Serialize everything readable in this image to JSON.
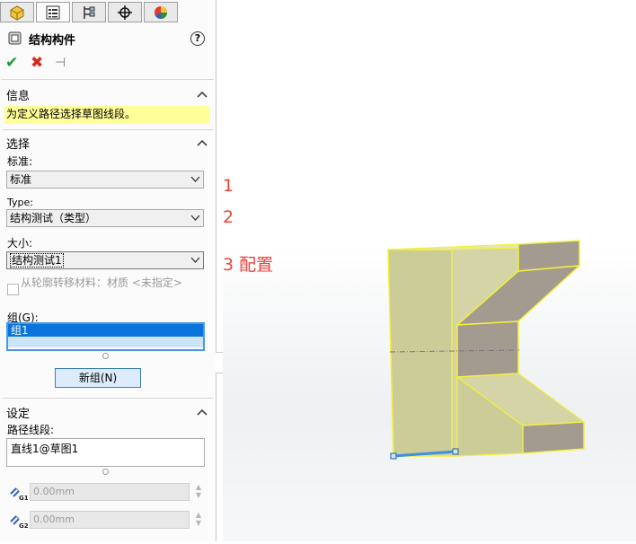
{
  "tabs": [
    {
      "icon": "feature-manager-icon"
    },
    {
      "icon": "property-manager-icon"
    },
    {
      "icon": "configuration-manager-icon"
    },
    {
      "icon": "dimxpert-icon"
    },
    {
      "icon": "display-manager-icon"
    }
  ],
  "header": {
    "title": "结构构件",
    "help": "?"
  },
  "actions": {
    "ok": "✔",
    "cancel": "✖",
    "pin": "⊣"
  },
  "info": {
    "title": "信息",
    "message": "为定义路径选择草图线段。"
  },
  "selection": {
    "title": "选择",
    "standard_label": "标准:",
    "standard_value": "标准",
    "type_label": "Type:",
    "type_value": "结构测试（类型）",
    "size_label": "大小:",
    "size_value": "结构测试1",
    "transfer_material_label": "从轮廓转移材料：材质 <未指定>",
    "group_label": "组(G):",
    "groups": [
      "组1"
    ],
    "new_group_button": "新组(N)"
  },
  "annotations": [
    "1",
    "2",
    "3 配置"
  ],
  "settings": {
    "title": "设定",
    "path_label": "路径线段:",
    "path_segments": [
      "直线1@草图1"
    ],
    "gap1": {
      "label": "G1",
      "value": "0.00mm"
    },
    "gap2": {
      "label": "G2",
      "value": "0.00mm"
    }
  },
  "colors": {
    "accent": "#0a74da",
    "annotation": "#e8443a",
    "info_bg": "#ffff99",
    "highlight": "#f5f53a"
  }
}
